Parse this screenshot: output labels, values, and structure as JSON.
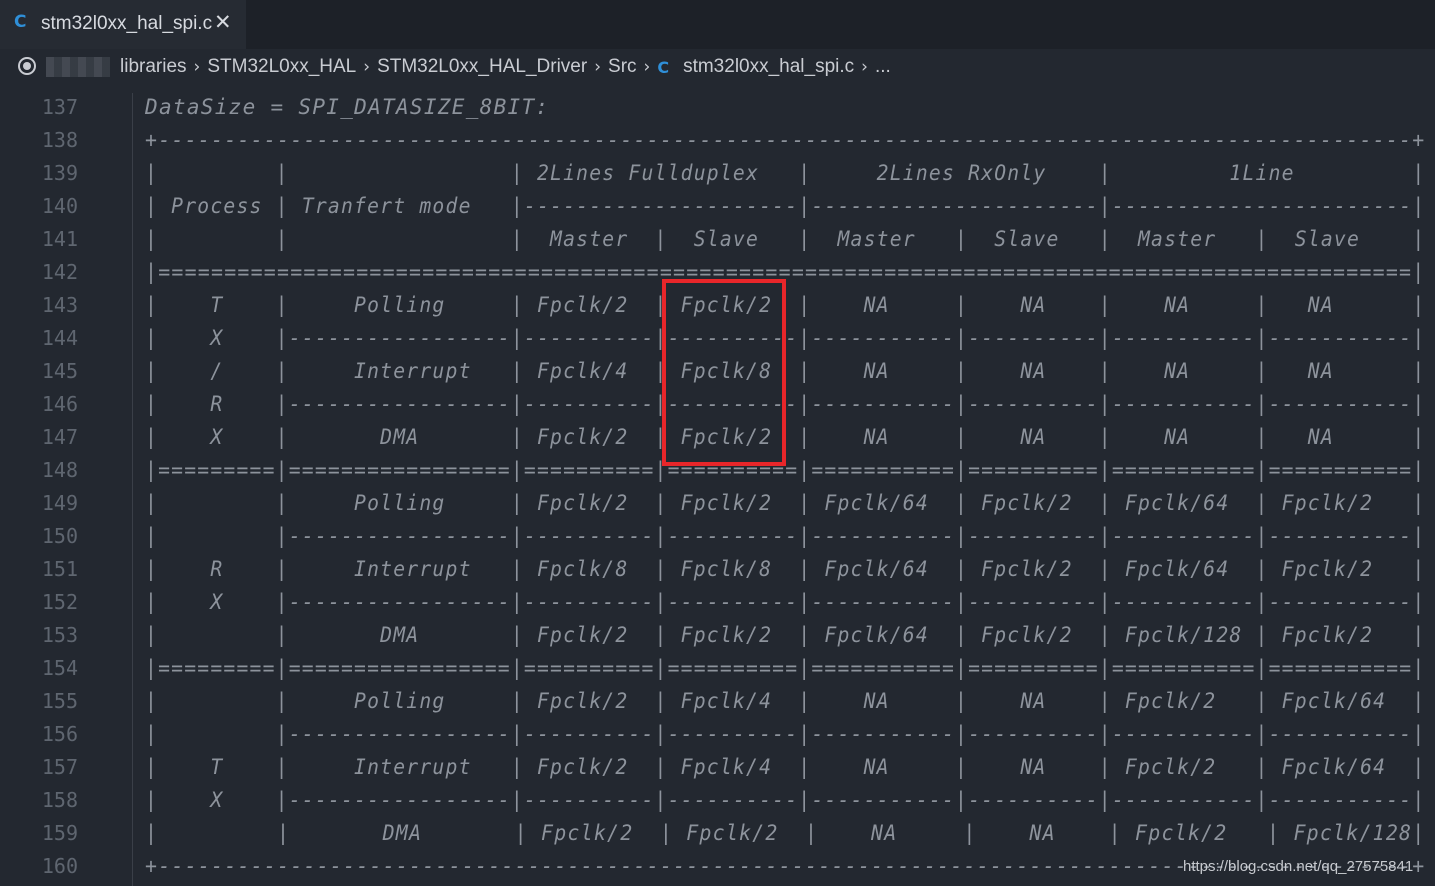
{
  "tab": {
    "icon": "c-file-icon",
    "icon_glyph": "C",
    "title": "stm32l0xx_hal_spi.c",
    "close_glyph": "✕"
  },
  "breadcrumb": {
    "items": [
      "libraries",
      "STM32L0xx_HAL",
      "STM32L0xx_HAL_Driver",
      "Src",
      "stm32l0xx_hal_spi.c",
      "..."
    ],
    "separator": "›",
    "file_icon_glyph": "C"
  },
  "editor": {
    "lines": [
      {
        "num": "137",
        "text": "DataSize = SPI_DATASIZE_8BIT:"
      },
      {
        "num": "138",
        "text": "+-----------------------------------------------------------------------------------------------+"
      },
      {
        "num": "139",
        "text": "|         |                 | 2Lines Fullduplex   |     2Lines RxOnly    |         1Line         |"
      },
      {
        "num": "140",
        "text": "| Process | Tranfert mode   |---------------------|----------------------|-----------------------|"
      },
      {
        "num": "141",
        "text": "|         |                 |  Master  |  Slave   |  Master   |  Slave   |  Master   |  Slave    |"
      },
      {
        "num": "142",
        "text": "|===============================================================================================|"
      },
      {
        "num": "143",
        "text": "|    T    |     Polling     | Fpclk/2  | Fpclk/2  |    NA     |    NA    |    NA     |   NA      |"
      },
      {
        "num": "144",
        "text": "|    X    |-----------------|----------|----------|-----------|----------|-----------|-----------|"
      },
      {
        "num": "145",
        "text": "|    /    |     Interrupt   | Fpclk/4  | Fpclk/8  |    NA     |    NA    |    NA     |   NA      |"
      },
      {
        "num": "146",
        "text": "|    R    |-----------------|----------|----------|-----------|----------|-----------|-----------|"
      },
      {
        "num": "147",
        "text": "|    X    |       DMA       | Fpclk/2  | Fpclk/2  |    NA     |    NA    |    NA     |   NA      |"
      },
      {
        "num": "148",
        "text": "|=========|=================|==========|==========|===========|==========|===========|===========|"
      },
      {
        "num": "149",
        "text": "|         |     Polling     | Fpclk/2  | Fpclk/2  | Fpclk/64  | Fpclk/2  | Fpclk/64  | Fpclk/2   |"
      },
      {
        "num": "150",
        "text": "|         |-----------------|----------|----------|-----------|----------|-----------|-----------|"
      },
      {
        "num": "151",
        "text": "|    R    |     Interrupt   | Fpclk/8  | Fpclk/8  | Fpclk/64  | Fpclk/2  | Fpclk/64  | Fpclk/2   |"
      },
      {
        "num": "152",
        "text": "|    X    |-----------------|----------|----------|-----------|----------|-----------|-----------|"
      },
      {
        "num": "153",
        "text": "|         |       DMA       | Fpclk/2  | Fpclk/2  | Fpclk/64  | Fpclk/2  | Fpclk/128 | Fpclk/2   |"
      },
      {
        "num": "154",
        "text": "|=========|=================|==========|==========|===========|==========|===========|===========|"
      },
      {
        "num": "155",
        "text": "|         |     Polling     | Fpclk/2  | Fpclk/4  |    NA     |    NA    | Fpclk/2   | Fpclk/64  |"
      },
      {
        "num": "156",
        "text": "|         |-----------------|----------|----------|-----------|----------|-----------|-----------|"
      },
      {
        "num": "157",
        "text": "|    T    |     Interrupt   | Fpclk/2  | Fpclk/4  |    NA     |    NA    | Fpclk/2   | Fpclk/64  |"
      },
      {
        "num": "158",
        "text": "|    X    |-----------------|----------|----------|-----------|----------|-----------|-----------|"
      },
      {
        "num": "159",
        "text": "|         |       DMA       | Fpclk/2  | Fpclk/2  |    NA     |    NA    | Fpclk/2   | Fpclk/128|"
      },
      {
        "num": "160",
        "text": "+-----------------------------------------------------------------------------------------------+"
      }
    ]
  },
  "watermark": "https://blog.csdn.net/qq_27575841",
  "colors": {
    "background": "#232830",
    "highlight_border": "#e8262a",
    "c_icon": "#2f8fd8"
  }
}
